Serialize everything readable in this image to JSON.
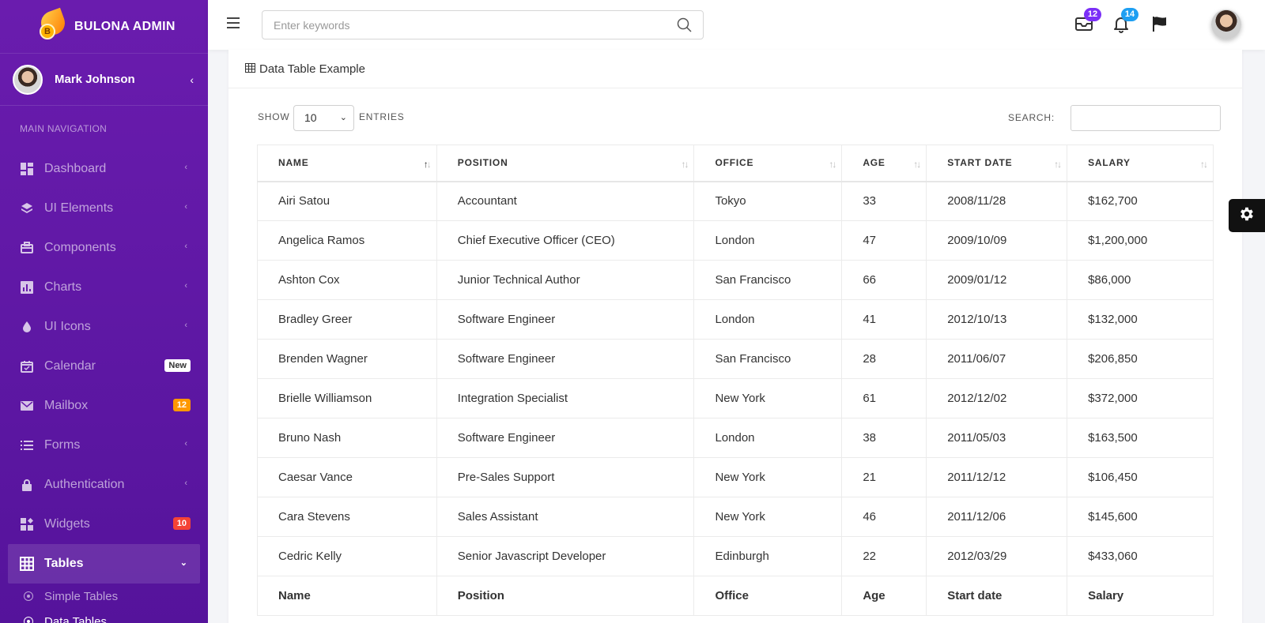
{
  "brand": {
    "name": "BULONA ADMIN",
    "logo_letter": "B"
  },
  "user": {
    "name": "Mark Johnson"
  },
  "nav": {
    "header": "MAIN NAVIGATION",
    "items": [
      {
        "label": "Dashboard",
        "icon": "dashboard-icon"
      },
      {
        "label": "UI Elements",
        "icon": "layers-icon"
      },
      {
        "label": "Components",
        "icon": "briefcase-icon"
      },
      {
        "label": "Charts",
        "icon": "bar-chart-icon"
      },
      {
        "label": "UI Icons",
        "icon": "drop-icon"
      },
      {
        "label": "Calendar",
        "icon": "calendar-icon",
        "badge": "New"
      },
      {
        "label": "Mailbox",
        "icon": "mail-icon",
        "badge": "12"
      },
      {
        "label": "Forms",
        "icon": "list-icon"
      },
      {
        "label": "Authentication",
        "icon": "lock-icon"
      },
      {
        "label": "Widgets",
        "icon": "widgets-icon",
        "badge": "10"
      },
      {
        "label": "Tables",
        "icon": "table-icon",
        "active": true
      }
    ],
    "sub_items": [
      {
        "label": "Simple Tables"
      },
      {
        "label": "Data Tables",
        "current": true
      }
    ]
  },
  "topbar": {
    "search_placeholder": "Enter keywords",
    "mail_count": "12",
    "notification_count": "14",
    "mail_badge_color": "#7b2ff7",
    "notification_badge_color": "#1e9ff2"
  },
  "card": {
    "title": "Data Table Example",
    "show_label": "SHOW",
    "entries_value": "10",
    "entries_label": "ENTRIES",
    "search_label": "SEARCH:"
  },
  "table": {
    "headers": [
      "NAME",
      "POSITION",
      "OFFICE",
      "AGE",
      "START DATE",
      "SALARY"
    ],
    "footers": [
      "Name",
      "Position",
      "Office",
      "Age",
      "Start date",
      "Salary"
    ],
    "rows": [
      [
        "Airi Satou",
        "Accountant",
        "Tokyo",
        "33",
        "2008/11/28",
        "$162,700"
      ],
      [
        "Angelica Ramos",
        "Chief Executive Officer (CEO)",
        "London",
        "47",
        "2009/10/09",
        "$1,200,000"
      ],
      [
        "Ashton Cox",
        "Junior Technical Author",
        "San Francisco",
        "66",
        "2009/01/12",
        "$86,000"
      ],
      [
        "Bradley Greer",
        "Software Engineer",
        "London",
        "41",
        "2012/10/13",
        "$132,000"
      ],
      [
        "Brenden Wagner",
        "Software Engineer",
        "San Francisco",
        "28",
        "2011/06/07",
        "$206,850"
      ],
      [
        "Brielle Williamson",
        "Integration Specialist",
        "New York",
        "61",
        "2012/12/02",
        "$372,000"
      ],
      [
        "Bruno Nash",
        "Software Engineer",
        "London",
        "38",
        "2011/05/03",
        "$163,500"
      ],
      [
        "Caesar Vance",
        "Pre-Sales Support",
        "New York",
        "21",
        "2011/12/12",
        "$106,450"
      ],
      [
        "Cara Stevens",
        "Sales Assistant",
        "New York",
        "46",
        "2011/12/06",
        "$145,600"
      ],
      [
        "Cedric Kelly",
        "Senior Javascript Developer",
        "Edinburgh",
        "22",
        "2012/03/29",
        "$433,060"
      ]
    ]
  },
  "colors": {
    "sidebar": "#6a1cae",
    "accent_orange": "#ff9800",
    "accent_red": "#f44336"
  }
}
